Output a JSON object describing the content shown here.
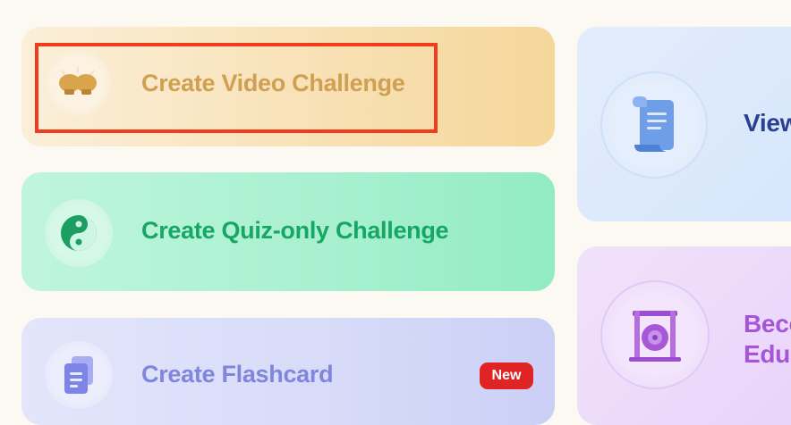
{
  "cards": {
    "video": {
      "label": "Create Video Challenge",
      "icon": "boxing-gloves-icon"
    },
    "quiz": {
      "label": "Create Quiz-only Challenge",
      "icon": "yin-yang-icon"
    },
    "flashcard": {
      "label": "Create Flashcard",
      "icon": "flashcard-icon",
      "badge": "New"
    },
    "view": {
      "label": "View",
      "icon": "scroll-icon"
    },
    "educator": {
      "line1": "Beco",
      "line2": "Edu",
      "icon": "gong-icon"
    }
  },
  "colors": {
    "highlight": "#f23c1e",
    "video_text": "#cf9f52",
    "quiz_text": "#16a765",
    "flash_text": "#7f86dc",
    "badge_bg": "#e02424",
    "view_text": "#2a3f8f",
    "edu_text": "#a654d8"
  }
}
